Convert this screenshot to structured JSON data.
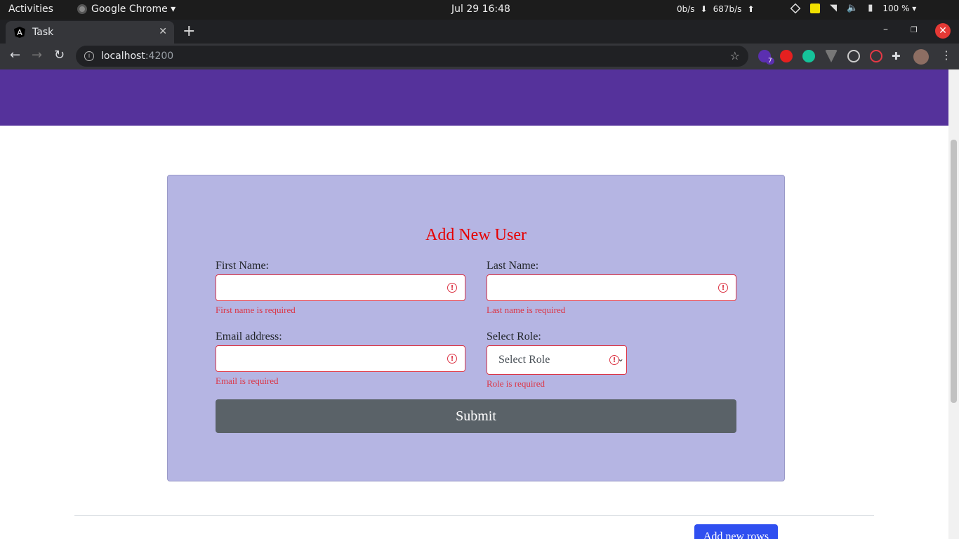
{
  "os_bar": {
    "activities": "Activities",
    "app_name": "Google Chrome ▾",
    "clock": "Jul 29  16:48",
    "net_down": "0b/s",
    "net_up": "687b/s",
    "battery": "100 % ▾"
  },
  "browser": {
    "tab_title": "Task",
    "tab_favicon": "A",
    "url_host": "localhost",
    "url_port": ":4200",
    "ext_badge": "7"
  },
  "form": {
    "title": "Add New User",
    "first_name_label": "First Name:",
    "first_name_error": "First name is required",
    "last_name_label": "Last Name:",
    "last_name_error": "Last name is required",
    "email_label": "Email address:",
    "email_error": "Email is required",
    "role_label": "Select Role:",
    "role_selected": "Select Role",
    "role_error": "Role is required",
    "submit_label": "Submit"
  },
  "table": {
    "add_rows_label": "Add new rows"
  },
  "colors": {
    "header_band": "#55329b",
    "form_bg": "#b5b5e3",
    "title": "#e60000",
    "error": "#dc3545",
    "submit_bg": "#5a6268",
    "add_rows_bg": "#2f4ff0"
  }
}
